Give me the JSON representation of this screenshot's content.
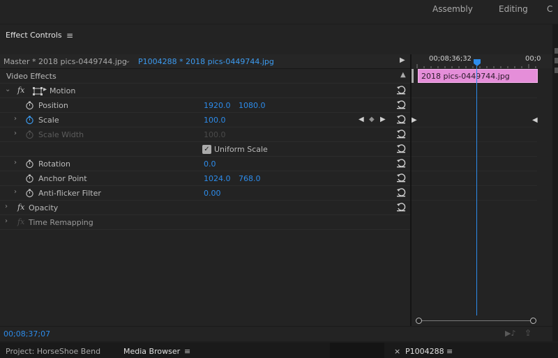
{
  "workspaces": {
    "assembly": "Assembly",
    "editing": "Editing",
    "overflow": "C"
  },
  "effect_controls": {
    "title": "Effect Controls",
    "master_clip": "Master * 2018 pics-0449744.jpg",
    "active_clip": "P1004288 * 2018 pics-0449744.jpg",
    "section_label": "Video Effects",
    "properties": {
      "motion": "Motion",
      "position": {
        "label": "Position",
        "x": "1920.0",
        "y": "1080.0"
      },
      "scale": {
        "label": "Scale",
        "value": "100.0"
      },
      "scale_width": {
        "label": "Scale Width",
        "value": "100.0"
      },
      "uniform_scale": {
        "label": "Uniform Scale",
        "checked": true
      },
      "rotation": {
        "label": "Rotation",
        "value": "0.0"
      },
      "anchor_point": {
        "label": "Anchor Point",
        "x": "1024.0",
        "y": "768.0"
      },
      "anti_flicker": {
        "label": "Anti-flicker Filter",
        "value": "0.00"
      },
      "opacity": "Opacity",
      "time_remapping": "Time Remapping"
    },
    "timecode": "00;08;37;07"
  },
  "timeline": {
    "ruler_time": "00;08;36;32",
    "ruler_time_next": "00;0",
    "clip_name": "2018 pics-0449744.jpg"
  },
  "bottom_tabs": {
    "project": "Project: HorseShoe Bend",
    "media_browser": "Media Browser",
    "sequence": "P1004288"
  },
  "colors": {
    "accent": "#2d8ceb",
    "clip": "#e58ed9",
    "playhead": "#2d8ceb"
  }
}
